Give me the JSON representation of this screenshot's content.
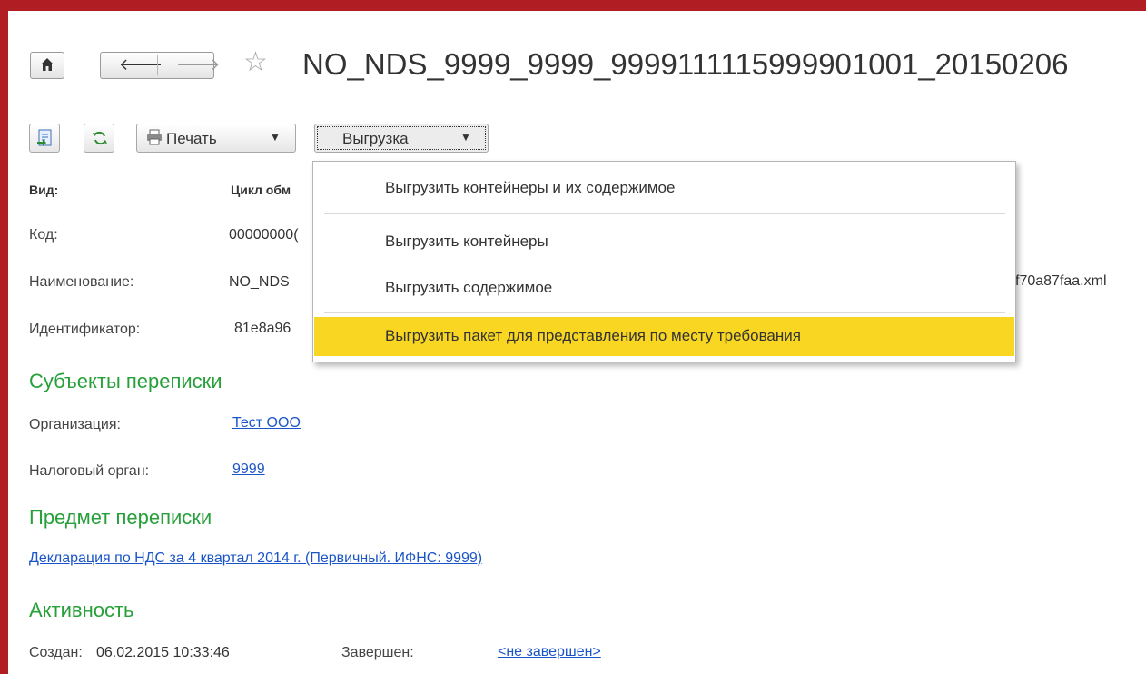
{
  "window": {
    "title": "NO_NDS_9999_9999_9999111115999901001_20150206"
  },
  "toolbar": {
    "print_label": "Печать",
    "export_label": "Выгрузка"
  },
  "fields": {
    "vid_label": "Вид:",
    "vid_value": "Цикл обм",
    "kod_label": "Код:",
    "kod_value": "00000000(",
    "name_label": "Наименование:",
    "name_value": "NO_NDS",
    "name_value_tail": "f70a87faa.xml",
    "id_label": "Идентификатор:",
    "id_value": "81e8a96"
  },
  "export_menu": {
    "items": [
      {
        "label": "Выгрузить контейнеры и их содержимое"
      },
      {
        "label": "Выгрузить контейнеры"
      },
      {
        "label": "Выгрузить содержимое"
      },
      {
        "label": "Выгрузить пакет для представления по месту требования"
      }
    ],
    "selected_index": 3
  },
  "subjects": {
    "heading": "Субъекты переписки",
    "org_label": "Организация:",
    "org_value": "Тест ООО",
    "tax_label": "Налоговый орган:",
    "tax_value": "9999"
  },
  "subject_matter": {
    "heading": "Предмет переписки",
    "link": "Декларация по НДС за 4 квартал 2014 г. (Первичный. ИФНС: 9999)"
  },
  "activity": {
    "heading": "Активность",
    "created_label": "Создан:",
    "created_value": "06.02.2015 10:33:46",
    "finished_label": "Завершен:",
    "finished_value": "<не завершен>"
  },
  "colors": {
    "frame": "#b01e24",
    "section_heading": "#27a03a",
    "link": "#1a55c8",
    "menu_highlight": "#f9d622"
  }
}
